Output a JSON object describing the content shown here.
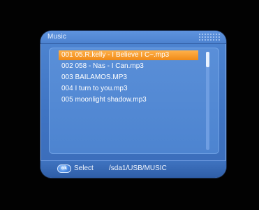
{
  "window": {
    "title": "Music"
  },
  "files": [
    {
      "label": "001 05.R.kelly - I Believe I C~.mp3",
      "selected": true
    },
    {
      "label": "002 058 - Nas - I Can.mp3",
      "selected": false
    },
    {
      "label": "003 BAILAMOS.MP3",
      "selected": false
    },
    {
      "label": "004 I turn to you.mp3",
      "selected": false
    },
    {
      "label": "005 moonlight shadow.mp3",
      "selected": false
    }
  ],
  "footer": {
    "ok_label": "ok",
    "select_label": "Select",
    "path": "/sda1/USB/MUSIC"
  },
  "colors": {
    "window_blue": "#4a7fcb",
    "selection_orange": "#f08a17",
    "background": "#000000"
  }
}
